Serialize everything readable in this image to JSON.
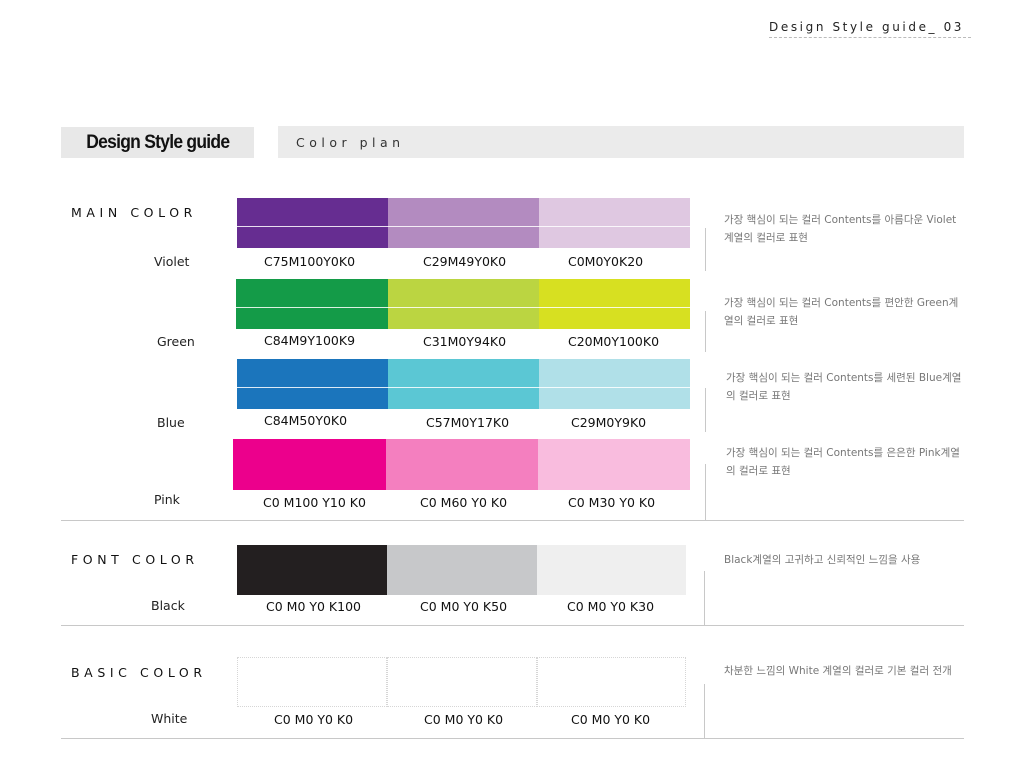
{
  "header": {
    "page_ref": "Design Style guide_ 03"
  },
  "title": {
    "main": "Design Style guide",
    "sub": "Color plan"
  },
  "main_color": {
    "label": "MAIN COLOR",
    "rows": [
      {
        "name": "Violet",
        "swatches": [
          {
            "code": "C75M100Y0K0",
            "hex": "#662d91"
          },
          {
            "code": "C29M49Y0K0",
            "hex": "#b38bc0"
          },
          {
            "code": "C0M0Y0K20",
            "hex": "#dfc8e1"
          }
        ],
        "note": "가장 핵심이 되는 컬러 Contents를 아름다운 Violet계열의 컬러로 표현"
      },
      {
        "name": "Green",
        "swatches": [
          {
            "code": "C84M9Y100K9",
            "hex": "#149b48"
          },
          {
            "code": "C31M0Y94K0",
            "hex": "#bbd541"
          },
          {
            "code": "C20M0Y100K0",
            "hex": "#d7e021"
          }
        ],
        "note": "가장 핵심이 되는 컬러 Contents를 편안한 Green계열의 컬러로 표현"
      },
      {
        "name": "Blue",
        "swatches": [
          {
            "code": "C84M50Y0K0",
            "hex": "#1b75bc"
          },
          {
            "code": "C57M0Y17K0",
            "hex": "#5bc7d4"
          },
          {
            "code": "C29M0Y9K0",
            "hex": "#b0e0e8"
          }
        ],
        "note": "가장 핵심이 되는 컬러 Contents를 세련된 Blue계열의 컬러로 표현"
      },
      {
        "name": "Pink",
        "swatches": [
          {
            "code": "C0 M100 Y10 K0",
            "hex": "#ec008c"
          },
          {
            "code": "C0 M60 Y0 K0",
            "hex": "#f47fbf"
          },
          {
            "code": "C0 M30 Y0 K0",
            "hex": "#f9bcde"
          }
        ],
        "note": "가장 핵심이 되는 컬러 Contents를 은은한 Pink계열의 컬러로 표현"
      }
    ]
  },
  "font_color": {
    "label": "FONT COLOR",
    "name": "Black",
    "swatches": [
      {
        "code": "C0 M0 Y0 K100",
        "hex": "#231f20"
      },
      {
        "code": "C0 M0 Y0 K50",
        "hex": "#c7c8ca"
      },
      {
        "code": "C0 M0 Y0 K30",
        "hex": "#efefef"
      }
    ],
    "note": "Black계열의 고귀하고 신뢰적인 느낌을 사용"
  },
  "basic_color": {
    "label": "BASIC COLOR",
    "name": "White",
    "swatches": [
      {
        "code": "C0 M0 Y0 K0",
        "hex": "#ffffff"
      },
      {
        "code": "C0 M0 Y0 K0",
        "hex": "#ffffff"
      },
      {
        "code": "C0 M0 Y0 K0",
        "hex": "#ffffff"
      }
    ],
    "note": "차분한 느낌의 White 계열의 컬러로 기본 컬러 전개"
  }
}
